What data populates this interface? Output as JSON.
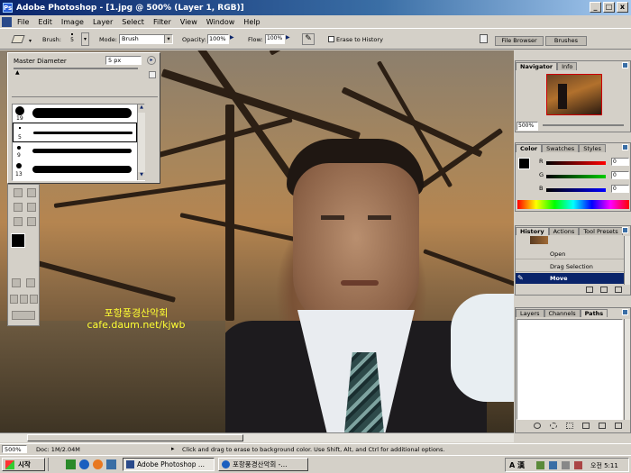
{
  "window": {
    "title": "Adobe Photoshop - [1.jpg @ 500% (Layer 1, RGB)]",
    "controls": [
      "_",
      "□",
      "x"
    ]
  },
  "menu": [
    "File",
    "Edit",
    "Image",
    "Layer",
    "Select",
    "Filter",
    "View",
    "Window",
    "Help"
  ],
  "options_bar": {
    "brush_label": "Brush:",
    "brush_size": "5",
    "mode_label": "Mode:",
    "mode_value": "Brush",
    "opacity_label": "Opacity:",
    "opacity_value": "100%",
    "flow_label": "Flow:",
    "flow_value": "100%",
    "erase_to_history_label": "Erase to History",
    "file_browser_tab": "File Browser",
    "brushes_tab": "Brushes"
  },
  "brush_panel": {
    "master_diameter_label": "Master Diameter",
    "master_diameter_value": "5 px",
    "presets": [
      {
        "size": "19"
      },
      {
        "size": "5"
      },
      {
        "size": "9"
      },
      {
        "size": "13"
      }
    ]
  },
  "canvas": {
    "watermark_line1": "포항풍경산악회",
    "watermark_line2": "cafe.daum.net/kjwb"
  },
  "navigator": {
    "tabs": [
      "Navigator",
      "Info"
    ],
    "zoom": "500%"
  },
  "color_panel": {
    "tabs": [
      "Color",
      "Swatches",
      "Styles"
    ],
    "channels": [
      {
        "label": "R",
        "value": "0"
      },
      {
        "label": "G",
        "value": "0"
      },
      {
        "label": "B",
        "value": "0"
      }
    ]
  },
  "history_panel": {
    "tabs": [
      "History",
      "Actions",
      "Tool Presets"
    ],
    "items": [
      "Open",
      "Drag Selection",
      "Move"
    ],
    "active_item": "Move"
  },
  "layers_panel": {
    "tabs": [
      "Layers",
      "Channels",
      "Paths"
    ]
  },
  "status_bar": {
    "zoom": "500%",
    "doc": "Doc: 1M/2.04M",
    "hint": "Click and drag to erase to background color. Use Shift, Alt, and Ctrl for additional options."
  },
  "taskbar": {
    "start": "시작",
    "items": [
      "Adobe Photoshop ...",
      "포항풍경산악회 -..."
    ],
    "tray_lang": "A 漢",
    "clock": "오전 5:11"
  },
  "colors": {
    "title_start": "#0a246a",
    "selection": "#0a246a",
    "watermark": "#ffff33",
    "history_active": "#0a246a"
  }
}
